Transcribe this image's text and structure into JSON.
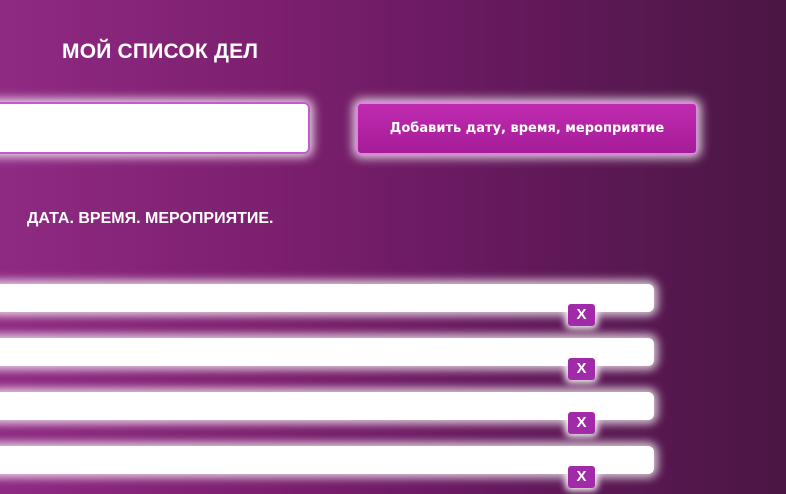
{
  "header": {
    "title": "МОЙ СПИСОК ДЕЛ"
  },
  "entry": {
    "value": "",
    "placeholder": ""
  },
  "add_button": {
    "label": "Добавить дату, время, мероприятие"
  },
  "list": {
    "heading": "ДАТА. ВРЕМЯ. МЕРОПРИЯТИЕ.",
    "delete_label": "X",
    "items": [
      {
        "text": ""
      },
      {
        "text": ""
      },
      {
        "text": ""
      },
      {
        "text": ""
      }
    ]
  }
}
